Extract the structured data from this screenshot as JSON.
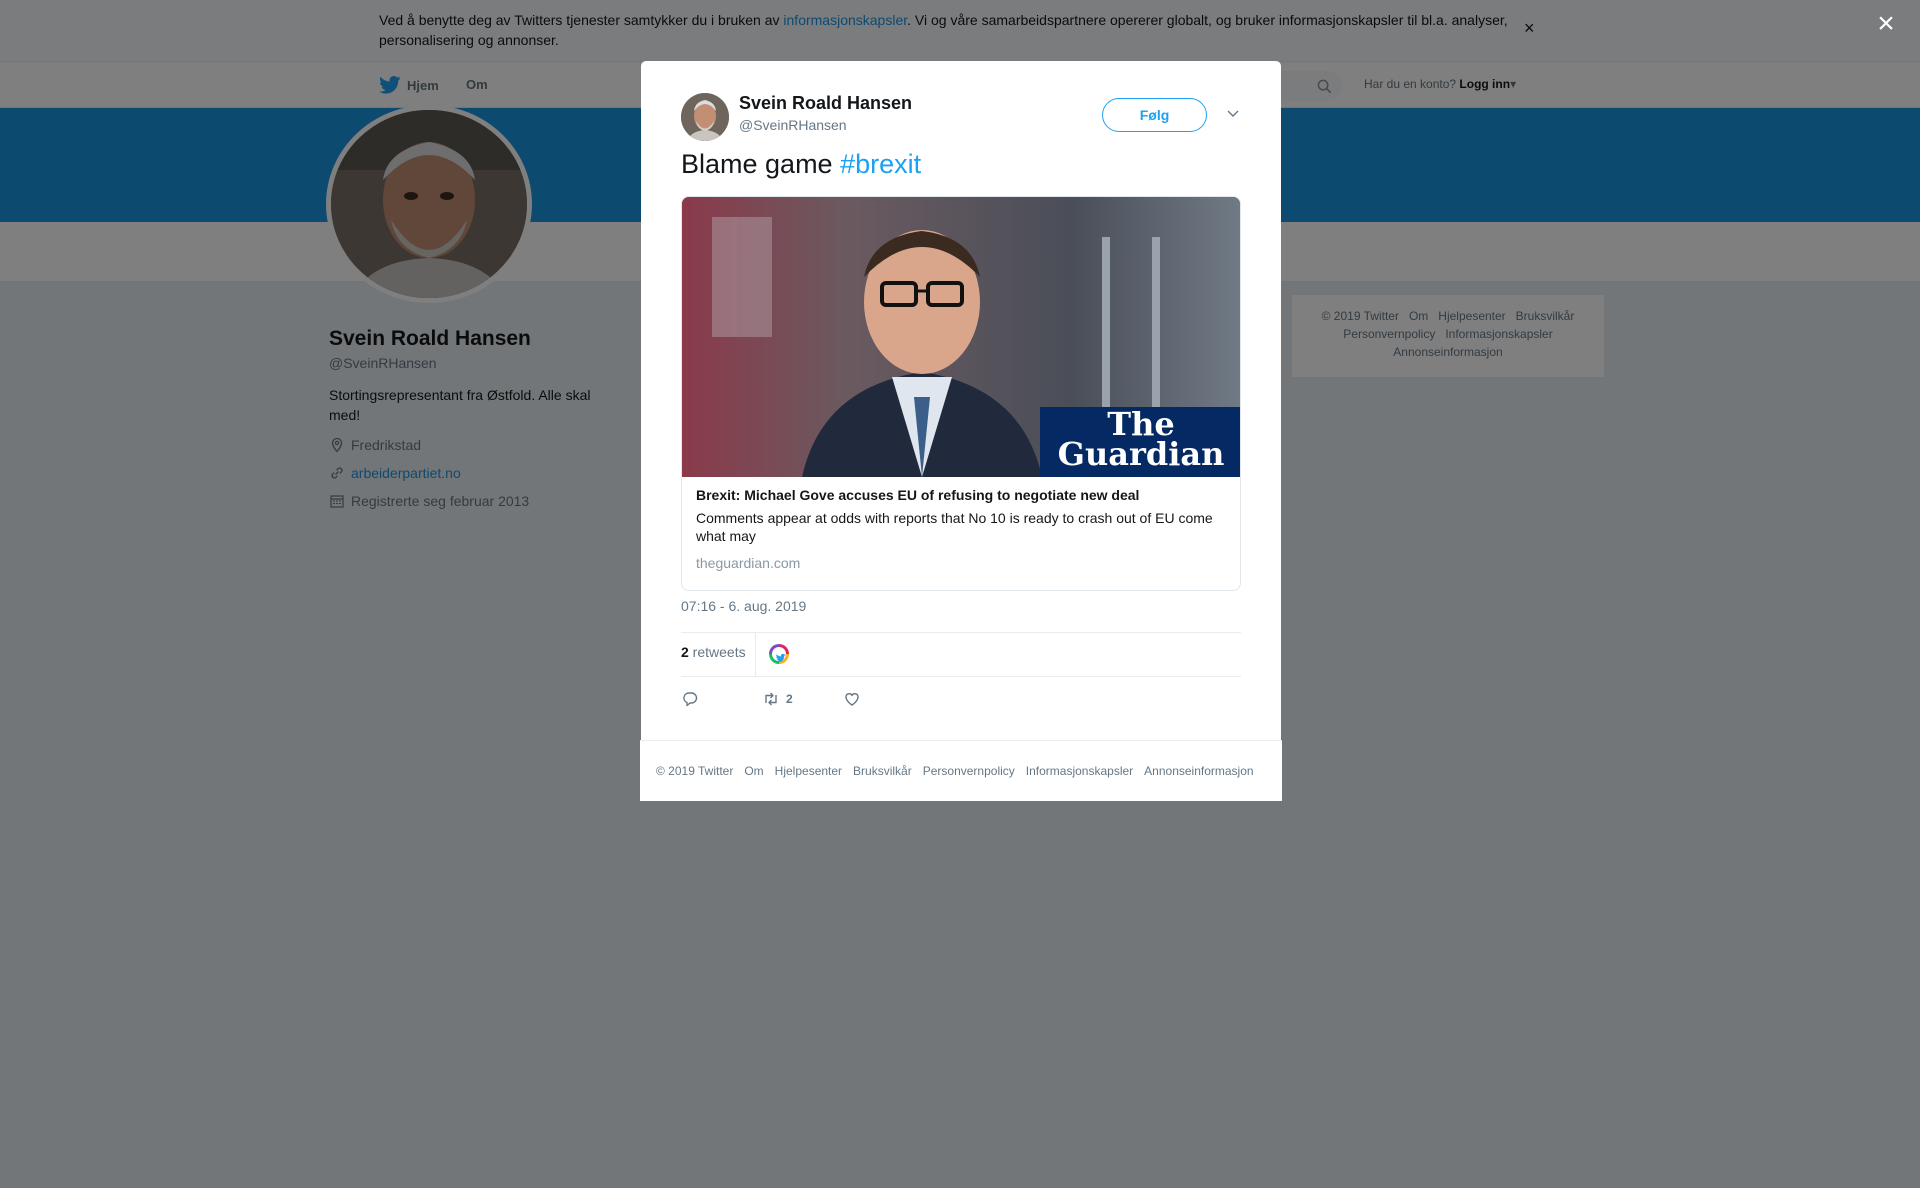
{
  "cookie_banner": {
    "text_before": "Ved å benytte deg av Twitters tjenester samtykker du i bruken av ",
    "link": "informasjonskapsler",
    "text_after": ". Vi og våre samarbeidspartnere opererer globalt, og bruker informasjonskapsler til bl.a. analyser, personalisering og annonser.",
    "close": "×"
  },
  "topnav": {
    "home": "Hjem",
    "about": "Om",
    "login_prompt": "Har du en konto?",
    "login": "Logg inn"
  },
  "profile": {
    "name": "Svein Roald Hansen",
    "handle": "@SveinRHansen",
    "bio": "Stortingsrepresentant fra Østfold. Alle skal med!",
    "location": "Fredrikstad",
    "website": "arbeiderpartiet.no",
    "joined": "Registrerte seg februar 2013"
  },
  "side_footer": {
    "links": [
      "© 2019 Twitter",
      "Om",
      "Hjelpesenter",
      "Bruksvilkår",
      "Personvernpolicy",
      "Informasjonskapsler",
      "Annonseinformasjon"
    ]
  },
  "overlay": {
    "close": "×"
  },
  "tweet": {
    "author_name": "Svein Roald Hansen",
    "author_handle": "@SveinRHansen",
    "follow_label": "Følg",
    "text": "Blame game ",
    "hashtag": "#brexit",
    "card": {
      "logo_line1": "The",
      "logo_line2": "Guardian",
      "title": "Brexit: Michael Gove accuses EU of refusing to negotiate new deal",
      "description": "Comments appear at odds with reports that No 10 is ready to crash out of EU come what may",
      "domain": "theguardian.com"
    },
    "timestamp": "07:16 - 6. aug. 2019",
    "retweet_count": "2",
    "retweets_label": " retweets",
    "action_retweet_count": "2"
  },
  "modal_footer": {
    "links": [
      "© 2019 Twitter",
      "Om",
      "Hjelpesenter",
      "Bruksvilkår",
      "Personvernpolicy",
      "Informasjonskapsler",
      "Annonseinformasjon"
    ]
  },
  "colors": {
    "accent": "#1da1f2",
    "banner": "#1b95e0",
    "link": "#1b95e0",
    "guardian_blue": "#052962"
  },
  "icons": [
    "twitter-bird-icon",
    "search-icon",
    "location-pin-icon",
    "link-icon",
    "calendar-icon",
    "chevron-down-icon",
    "reply-icon",
    "retweet-icon",
    "heart-icon",
    "close-icon"
  ]
}
